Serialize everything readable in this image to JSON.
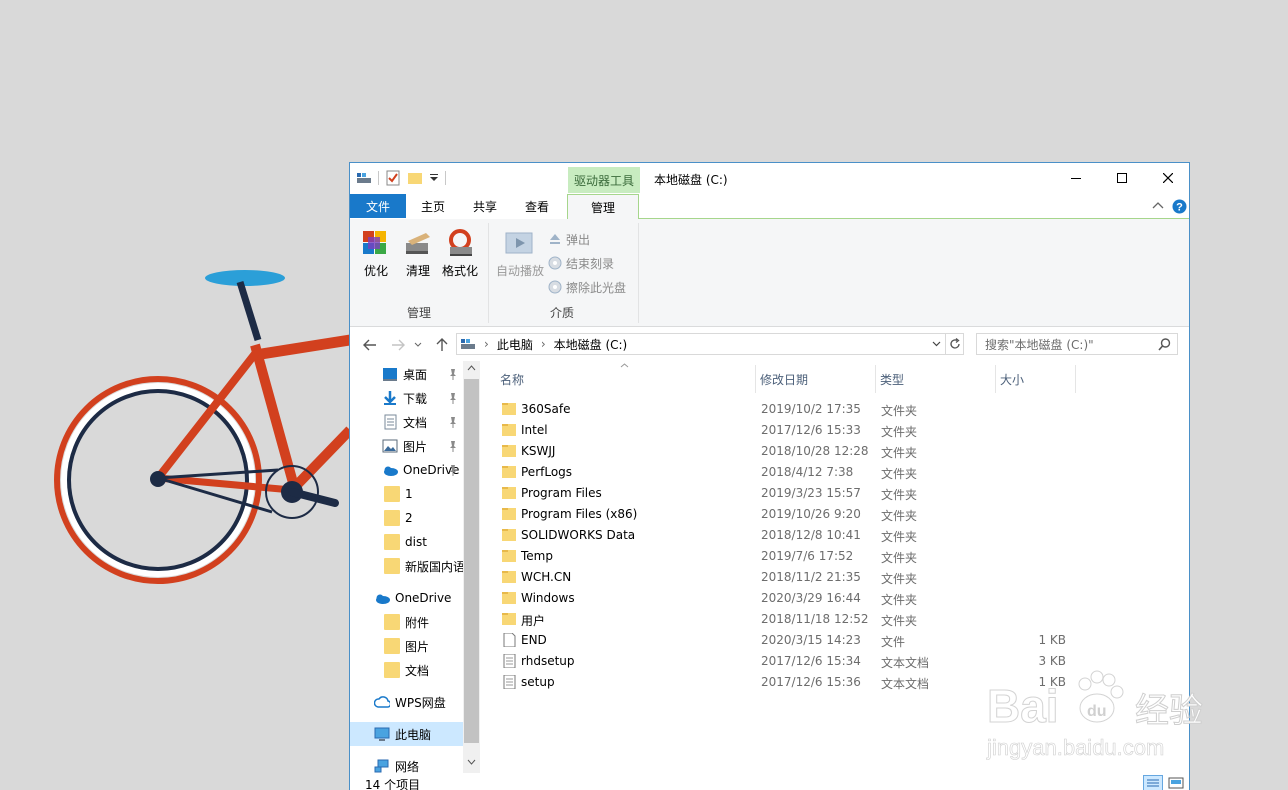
{
  "window": {
    "title": "本地磁盘 (C:)",
    "context_tab": "驱动器工具",
    "controls": [
      "minimize",
      "maximize",
      "close"
    ]
  },
  "tabs": [
    "文件",
    "主页",
    "共享",
    "查看",
    "管理"
  ],
  "ribbon": {
    "manage_group": {
      "label": "管理",
      "buttons": [
        "优化",
        "清理",
        "格式化"
      ]
    },
    "media_group": {
      "label": "介质",
      "autoplay": "自动播放",
      "eject": "弹出",
      "finish_burn": "结束刻录",
      "erase_disc": "擦除此光盘"
    }
  },
  "address": {
    "crumbs": [
      "此电脑",
      "本地磁盘 (C:)"
    ],
    "search_placeholder": "搜索\"本地磁盘 (C:)\""
  },
  "nav": {
    "quick": [
      "桌面",
      "下载",
      "文档",
      "图片",
      "OneDrive",
      "1",
      "2",
      "dist",
      "新版国内语"
    ],
    "onedrive": "OneDrive",
    "onedrive_children": [
      "附件",
      "图片",
      "文档"
    ],
    "wps": "WPS网盘",
    "this_pc": "此电脑",
    "network": "网络"
  },
  "columns": [
    "名称",
    "修改日期",
    "类型",
    "大小"
  ],
  "files": [
    {
      "name": "360Safe",
      "date": "2019/10/2 17:35",
      "type": "文件夹",
      "size": "",
      "kind": "folder"
    },
    {
      "name": "Intel",
      "date": "2017/12/6 15:33",
      "type": "文件夹",
      "size": "",
      "kind": "folder"
    },
    {
      "name": "KSWJJ",
      "date": "2018/10/28 12:28",
      "type": "文件夹",
      "size": "",
      "kind": "folder"
    },
    {
      "name": "PerfLogs",
      "date": "2018/4/12 7:38",
      "type": "文件夹",
      "size": "",
      "kind": "folder"
    },
    {
      "name": "Program Files",
      "date": "2019/3/23 15:57",
      "type": "文件夹",
      "size": "",
      "kind": "folder"
    },
    {
      "name": "Program Files (x86)",
      "date": "2019/10/26 9:20",
      "type": "文件夹",
      "size": "",
      "kind": "folder"
    },
    {
      "name": "SOLIDWORKS Data",
      "date": "2018/12/8 10:41",
      "type": "文件夹",
      "size": "",
      "kind": "folder"
    },
    {
      "name": "Temp",
      "date": "2019/7/6 17:52",
      "type": "文件夹",
      "size": "",
      "kind": "folder"
    },
    {
      "name": "WCH.CN",
      "date": "2018/11/2 21:35",
      "type": "文件夹",
      "size": "",
      "kind": "folder"
    },
    {
      "name": "Windows",
      "date": "2020/3/29 16:44",
      "type": "文件夹",
      "size": "",
      "kind": "folder"
    },
    {
      "name": "用户",
      "date": "2018/11/18 12:52",
      "type": "文件夹",
      "size": "",
      "kind": "folder"
    },
    {
      "name": "END",
      "date": "2020/3/15 14:23",
      "type": "文件",
      "size": "1 KB",
      "kind": "file"
    },
    {
      "name": "rhdsetup",
      "date": "2017/12/6 15:34",
      "type": "文本文档",
      "size": "3 KB",
      "kind": "text"
    },
    {
      "name": "setup",
      "date": "2017/12/6 15:36",
      "type": "文本文档",
      "size": "1 KB",
      "kind": "text"
    }
  ],
  "status": {
    "item_count": "14 个项目"
  },
  "watermark": {
    "line1": "Bai",
    "line2": "经验",
    "url": "jingyan.baidu.com"
  },
  "colors": {
    "accent": "#1979ca",
    "drive_tools": "#c8ecc0",
    "folder": "#f8d775",
    "bike_frame": "#d2401e",
    "bike_dark": "#1d2b45",
    "seat": "#2b9fd8"
  }
}
